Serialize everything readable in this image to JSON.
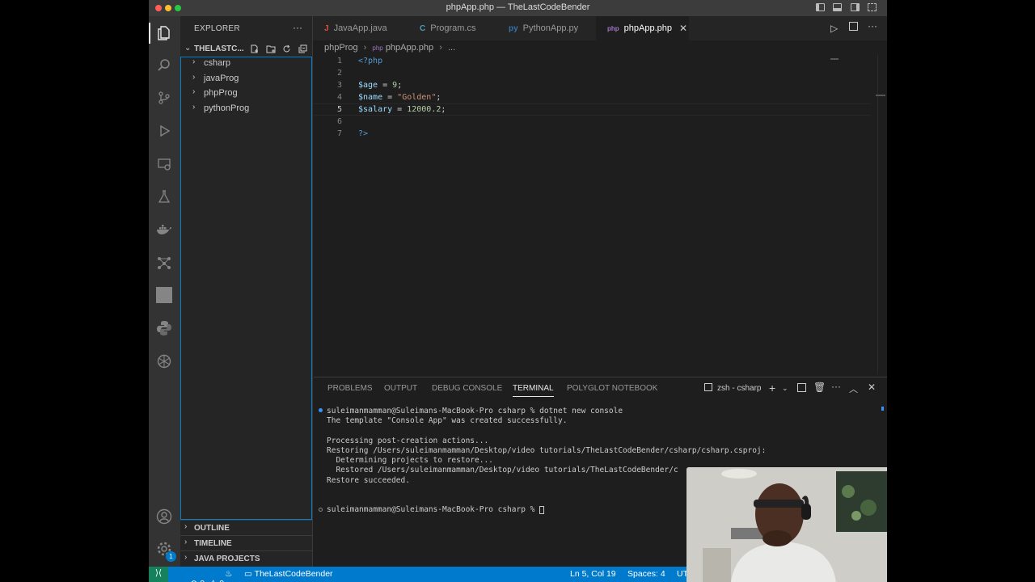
{
  "window": {
    "title": "phpApp.php — TheLastCodeBender"
  },
  "sidebar": {
    "header": "EXPLORER",
    "more": "···",
    "workspace": "THELASTC...",
    "folders": [
      {
        "label": "csharp"
      },
      {
        "label": "javaProg"
      },
      {
        "label": "phpProg"
      },
      {
        "label": "pythonProg"
      }
    ],
    "panels": [
      {
        "label": "OUTLINE"
      },
      {
        "label": "TIMELINE"
      },
      {
        "label": "JAVA PROJECTS"
      }
    ]
  },
  "tabs": [
    {
      "label": "JavaApp.java",
      "icon": "J",
      "icon_color": "#e44d3a"
    },
    {
      "label": "Program.cs",
      "icon": "C",
      "icon_color": "#519aba"
    },
    {
      "label": "PythonApp.py",
      "icon": "py",
      "icon_color": "#3572a5"
    },
    {
      "label": "phpApp.php",
      "icon": "php",
      "icon_color": "#a074c4",
      "active": true
    }
  ],
  "breadcrumb": {
    "folder": "phpProg",
    "file": "phpApp.php",
    "more": "..."
  },
  "code": [
    {
      "n": "1",
      "text": "<?php"
    },
    {
      "n": "2",
      "text": ""
    },
    {
      "n": "3",
      "text": "$age = 9;"
    },
    {
      "n": "4",
      "text": "$name = \"Golden\";"
    },
    {
      "n": "5",
      "text": "$salary = 12000.2;"
    },
    {
      "n": "6",
      "text": ""
    },
    {
      "n": "7",
      "text": "?>"
    }
  ],
  "panel": {
    "tabs": [
      "PROBLEMS",
      "OUTPUT",
      "DEBUG CONSOLE",
      "TERMINAL",
      "POLYGLOT NOTEBOOK"
    ],
    "active_tab": "TERMINAL",
    "terminal_name": "zsh - csharp"
  },
  "terminal": [
    "suleimanmamman@Suleimans-MacBook-Pro csharp % dotnet new console",
    "The template \"Console App\" was created successfully.",
    "",
    "Processing post-creation actions...",
    "Restoring /Users/suleimanmamman/Desktop/video tutorials/TheLastCodeBender/csharp/csharp.csproj:",
    "  Determining projects to restore...",
    "  Restored /Users/suleimanmamman/Desktop/video tutorials/TheLastCodeBender/c",
    "Restore succeeded.",
    "",
    "",
    "suleimanmamman@Suleimans-MacBook-Pro csharp % "
  ],
  "status": {
    "errors": "0",
    "warnings": "0",
    "repo": "TheLastCodeBender",
    "position": "Ln 5, Col 19",
    "spaces": "Spaces: 4",
    "encoding": "UT",
    "notifications": "1"
  },
  "colors": {
    "statusbar": "#007acc",
    "accent": "#007fd4"
  }
}
